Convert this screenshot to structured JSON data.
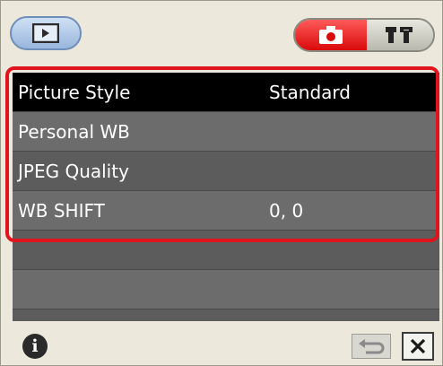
{
  "toolbar": {
    "playback_icon": "playback-icon",
    "camera_tab_icon": "camera-icon",
    "tools_tab_icon": "tools-icon"
  },
  "menu": {
    "items": [
      {
        "label": "Picture Style",
        "value": "Standard",
        "selected": true
      },
      {
        "label": "Personal WB",
        "value": ""
      },
      {
        "label": "JPEG Quality",
        "value": ""
      },
      {
        "label": "WB SHIFT",
        "value": "0, 0"
      }
    ]
  },
  "bottom_bar": {
    "info_label": "i",
    "info_icon": "info-icon",
    "return_icon": "return-icon",
    "close_icon": "close-icon"
  },
  "colors": {
    "highlight": "#e0141e",
    "camera_tab": "#e01414",
    "selected_row": "#000000"
  }
}
